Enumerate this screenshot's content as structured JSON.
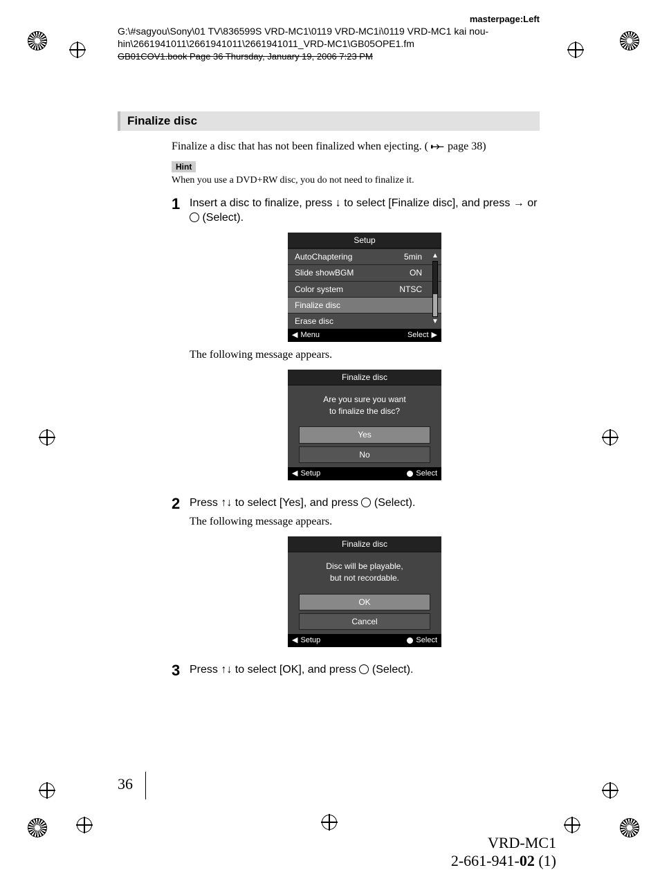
{
  "header": {
    "masterpage": "masterpage:Left",
    "path_line1": "G:\\#sagyou\\Sony\\01 TV\\836599S VRD-MC1\\0119 VRD-MC1i\\0119 VRD-MC1 kai nou-",
    "path_line2": "hin\\2661941011\\2661941011\\2661941011_VRD-MC1\\GB05OPE1.fm",
    "overprint": "GB01COV1.book  Page 36  Thursday, January 19, 2006  7:23 PM"
  },
  "section_title": "Finalize disc",
  "intro": {
    "text_before": "Finalize a disc that has not been finalized when ejecting. (",
    "page_ref": " page 38)",
    "hint_label": "Hint",
    "hint_text": "When you use a DVD+RW disc, you do not need to finalize it."
  },
  "steps": {
    "s1": {
      "num": "1",
      "text_a": "Insert a disc to finalize, press ",
      "text_b": " to select [Finalize disc], and press ",
      "text_c": " or ",
      "text_d": " (Select).",
      "followup": "The following message appears."
    },
    "s2": {
      "num": "2",
      "text_a": "Press ",
      "text_b": " to select [Yes], and press ",
      "text_c": " (Select).",
      "followup": "The following message appears."
    },
    "s3": {
      "num": "3",
      "text_a": "Press ",
      "text_b": " to select [OK], and press ",
      "text_c": " (Select)."
    }
  },
  "osd1": {
    "title": "Setup",
    "rows": [
      {
        "label": "AutoChaptering",
        "value": "5min"
      },
      {
        "label": "Slide showBGM",
        "value": "ON"
      },
      {
        "label": "Color system",
        "value": "NTSC"
      },
      {
        "label": "Finalize disc",
        "value": "",
        "selected": true
      },
      {
        "label": "Erase disc",
        "value": ""
      }
    ],
    "footer_left": "Menu",
    "footer_right": "Select"
  },
  "osd2": {
    "title": "Finalize disc",
    "message_l1": "Are you sure you want",
    "message_l2": "to finalize the disc?",
    "btn1": "Yes",
    "btn2": "No",
    "footer_left": "Setup",
    "footer_right": "Select"
  },
  "osd3": {
    "title": "Finalize disc",
    "message_l1": "Disc will be playable,",
    "message_l2": "but not recordable.",
    "btn1": "OK",
    "btn2": "Cancel",
    "footer_left": "Setup",
    "footer_right": "Select"
  },
  "page_number": "36",
  "footer": {
    "model": "VRD-MC1",
    "partno_a": "2-661-941-",
    "partno_b": "02",
    "partno_c": " (1)"
  }
}
